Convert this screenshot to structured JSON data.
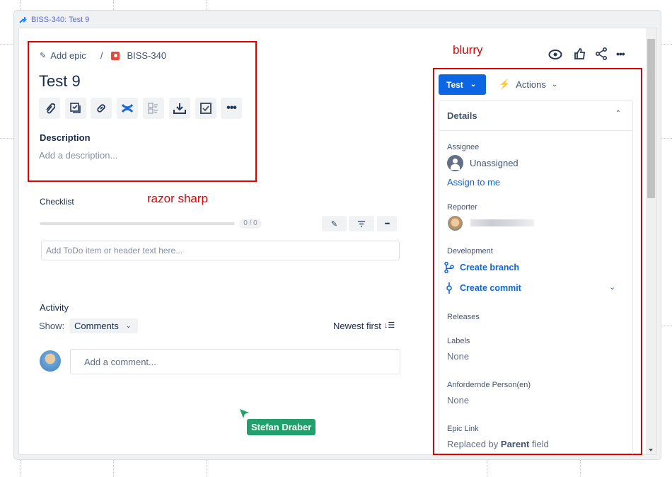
{
  "window": {
    "title": "BISS-340: Test 9"
  },
  "breadcrumb": {
    "add_epic": "Add epic",
    "separator": "/",
    "issue_key": "BISS-340"
  },
  "issue": {
    "title": "Test 9"
  },
  "toolbar_icons": [
    "attachment-icon",
    "subtask-icon",
    "link-icon",
    "confluence-icon",
    "checklist-icon",
    "download-icon",
    "checkbox-icon",
    "more-icon"
  ],
  "description": {
    "label": "Description",
    "placeholder": "Add a description..."
  },
  "checklist": {
    "label": "Checklist",
    "progress": "0 / 0",
    "progress_fraction": 0,
    "input_placeholder": "Add ToDo item or header text here..."
  },
  "activity": {
    "label": "Activity",
    "show_label": "Show:",
    "show_value": "Comments",
    "sort": "Newest first",
    "comment_placeholder": "Add a comment..."
  },
  "cursor": {
    "user": "Stefan Draber"
  },
  "annotations": {
    "left": "razor sharp",
    "right": "blurry"
  },
  "sidebar": {
    "status_button": "Test",
    "actions": "Actions",
    "details_title": "Details",
    "assignee": {
      "label": "Assignee",
      "value": "Unassigned",
      "assign_link": "Assign to me"
    },
    "reporter": {
      "label": "Reporter"
    },
    "development": {
      "label": "Development",
      "create_branch": "Create branch",
      "create_commit": "Create commit"
    },
    "releases": {
      "label": "Releases"
    },
    "labels": {
      "label": "Labels",
      "value": "None"
    },
    "requester": {
      "label": "Anfordernde Person(en)",
      "value": "None"
    },
    "epic_link": {
      "label": "Epic Link",
      "prefix": "Replaced by",
      "bold": "Parent",
      "suffix": "field"
    }
  },
  "colors": {
    "accent": "#0c66e4",
    "annotation": "#e00000",
    "cursor": "#22a06b",
    "issue_type": "#e5493a"
  }
}
